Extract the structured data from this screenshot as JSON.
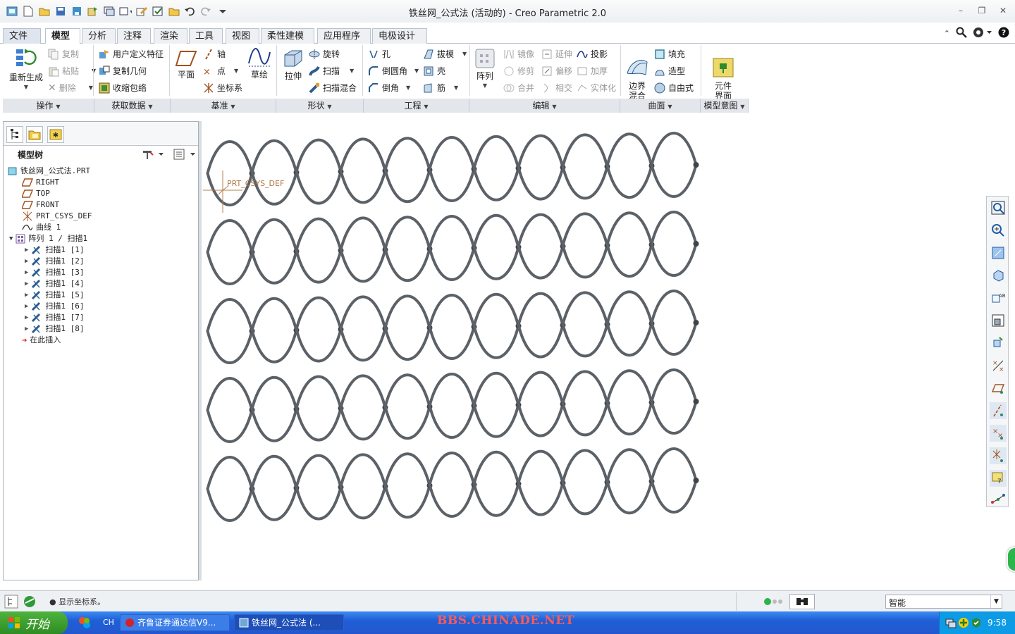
{
  "window": {
    "title": "铁丝网_公式法 (活动的) - Creo Parametric 2.0"
  },
  "tabs": [
    "文件",
    "模型",
    "分析",
    "注释",
    "渲染",
    "工具",
    "视图",
    "柔性建模",
    "应用程序",
    "电极设计"
  ],
  "ribbon": {
    "regen": "重新生成",
    "copy": "复制",
    "paste": "粘贴",
    "delete": "删除",
    "udf": "用户定义特征",
    "copy_geom": "复制几何",
    "shrinkwrap": "收缩包络",
    "plane": "平面",
    "axis": "轴",
    "point": "点",
    "csys": "坐标系",
    "sketch": "草绘",
    "extrude": "拉伸",
    "revolve": "旋转",
    "sweep": "扫描",
    "swept_blend": "扫描混合",
    "hole": "孔",
    "round": "倒圆角",
    "chamfer": "倒角",
    "draft": "拔模",
    "shell": "壳",
    "rib": "筋",
    "pattern": "阵列",
    "mirror": "镜像",
    "trim": "修剪",
    "merge": "合并",
    "extend": "延伸",
    "offset": "偏移",
    "intersect": "相交",
    "project": "投影",
    "thicken": "加厚",
    "solidify": "实体化",
    "boundary_blend": "边界\n混合",
    "fill": "填充",
    "style": "造型",
    "freestyle": "自由式",
    "component_interface": "元件\n界面",
    "groups": [
      "操作",
      "获取数据",
      "基准",
      "形状",
      "工程",
      "编辑",
      "曲面",
      "模型意图"
    ]
  },
  "tree": {
    "header": "模型树",
    "items": [
      "铁丝网_公式法.PRT",
      "RIGHT",
      "TOP",
      "FRONT",
      "PRT_CSYS_DEF",
      "曲线 1",
      "阵列 1 / 扫描1",
      "扫描1 [1]",
      "扫描1 [2]",
      "扫描1 [3]",
      "扫描1 [4]",
      "扫描1 [5]",
      "扫描1 [6]",
      "扫描1 [7]",
      "扫描1 [8]",
      "在此插入"
    ]
  },
  "graphics": {
    "csys_label": "PRT_CSYS_DEF",
    "wire_color": "#5b6167"
  },
  "status": {
    "message": "● 显示坐标系。",
    "filter": "智能"
  },
  "taskbar": {
    "start": "开始",
    "lang": "CH",
    "tasks": [
      "齐鲁证券通达信V9...",
      "铁丝网_公式法 (..."
    ],
    "watermark": "BBS.CHINADE.NET",
    "clock": "9:58"
  }
}
